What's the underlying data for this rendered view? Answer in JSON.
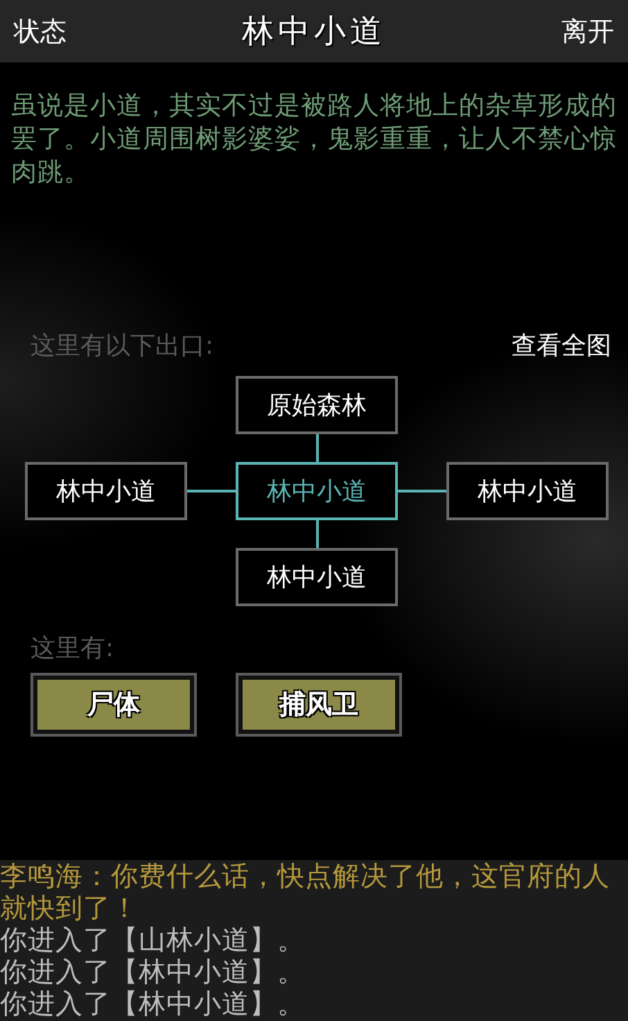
{
  "header": {
    "left_button": "状态",
    "title": "林中小道",
    "right_button": "离开"
  },
  "description": "虽说是小道，其实不过是被路人将地上的杂草形成的罢了。小道周围树影婆娑，鬼影重重，让人不禁心惊肉跳。",
  "exits": {
    "label": "这里有以下出口:",
    "map_button": "查看全图",
    "rooms": [
      {
        "kind": "north",
        "name": "原始森林",
        "selected": false
      },
      {
        "kind": "west",
        "name": "林中小道",
        "selected": false
      },
      {
        "kind": "center",
        "name": "林中小道",
        "selected": true
      },
      {
        "kind": "east",
        "name": "林中小道",
        "selected": false
      },
      {
        "kind": "south",
        "name": "林中小道",
        "selected": false
      }
    ]
  },
  "here": {
    "label": "这里有:",
    "objects": [
      "尸体",
      "捕风卫"
    ]
  },
  "log": [
    {
      "kind": "speech",
      "text": "李鸣海：你费什么话，快点解决了他，这官府的人就快到了！"
    },
    {
      "kind": "system",
      "text": "你进入了【山林小道】。"
    },
    {
      "kind": "system",
      "text": "你进入了【林中小道】。"
    },
    {
      "kind": "system",
      "text": "你进入了【林中小道】。"
    }
  ]
}
